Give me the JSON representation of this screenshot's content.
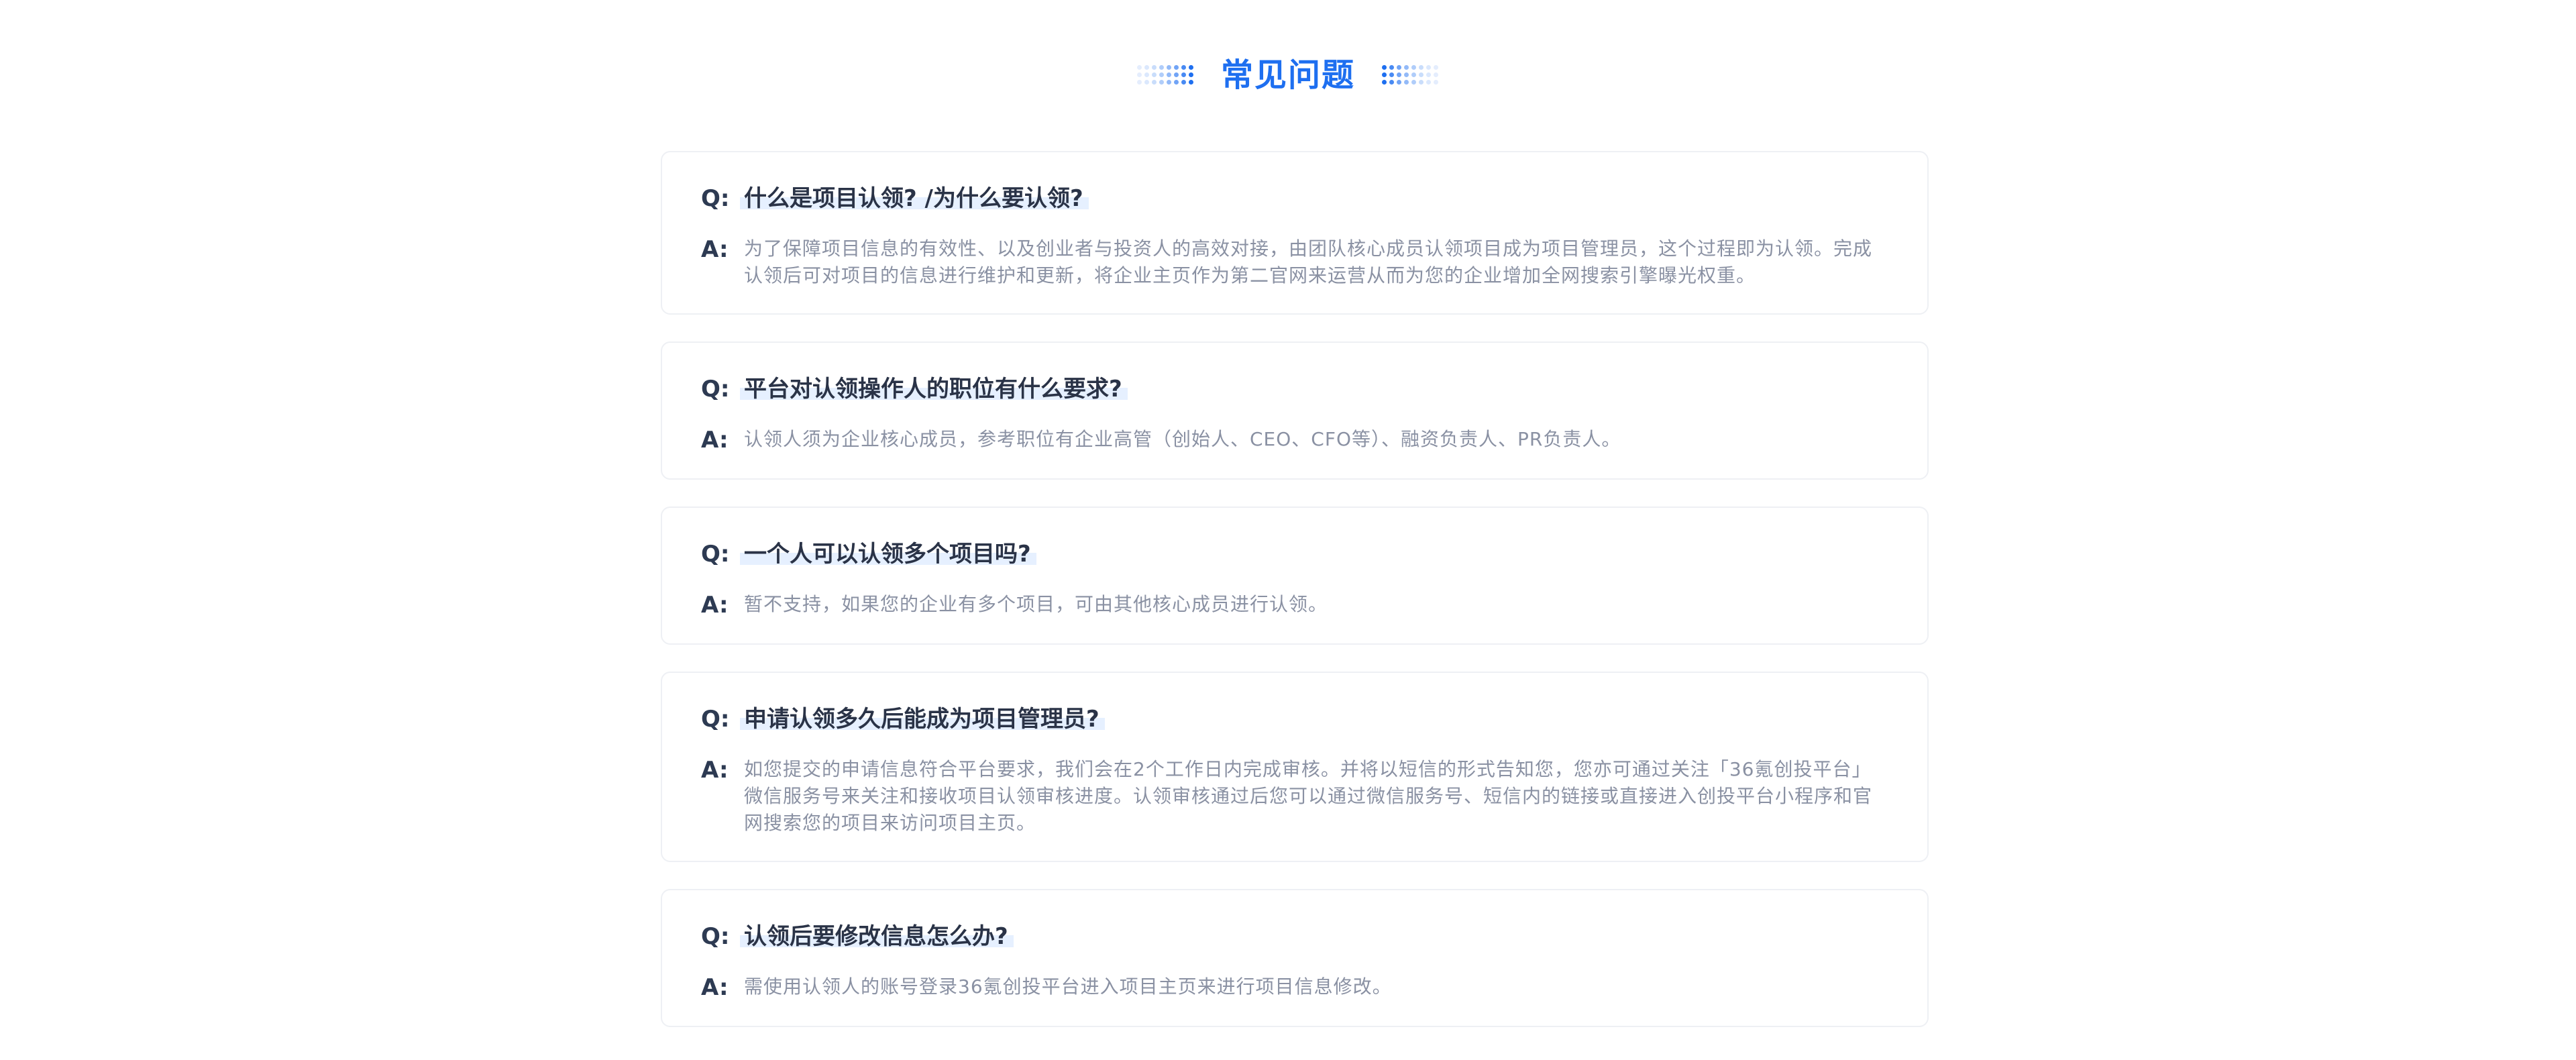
{
  "header": {
    "title": "常见问题"
  },
  "labels": {
    "q": "Q:",
    "a": "A:"
  },
  "faq": [
    {
      "question": "什么是项目认领? /为什么要认领?",
      "answer": "为了保障项目信息的有效性、以及创业者与投资人的高效对接，由团队核心成员认领项目成为项目管理员，这个过程即为认领。完成认领后可对项目的信息进行维护和更新，将企业主页作为第二官网来运营从而为您的企业增加全网搜索引擎曝光权重。"
    },
    {
      "question": "平台对认领操作人的职位有什么要求?",
      "answer": "认领人须为企业核心成员，参考职位有企业高管（创始人、CEO、CFO等）、融资负责人、PR负责人。"
    },
    {
      "question": "一个人可以认领多个项目吗?",
      "answer": "暂不支持，如果您的企业有多个项目，可由其他核心成员进行认领。"
    },
    {
      "question": "申请认领多久后能成为项目管理员?",
      "answer": "如您提交的申请信息符合平台要求，我们会在2个工作日内完成审核。并将以短信的形式告知您，您亦可通过关注「36氪创投平台」微信服务号来关注和接收项目认领审核进度。认领审核通过后您可以通过微信服务号、短信内的链接或直接进入创投平台小程序和官网搜索您的项目来访问项目主页。"
    },
    {
      "question": "认领后要修改信息怎么办?",
      "answer": "需使用认领人的账号登录36氪创投平台进入项目主页来进行项目信息修改。"
    }
  ],
  "colors": {
    "accent": "#1e6ff0",
    "question_text": "#2a3347",
    "answer_text": "#8a91a3",
    "highlight": "#e6f0ff",
    "card_border": "#eef0f4"
  },
  "icons": {
    "left_decoration": "dot-grid-left-icon",
    "right_decoration": "dot-grid-right-icon"
  }
}
